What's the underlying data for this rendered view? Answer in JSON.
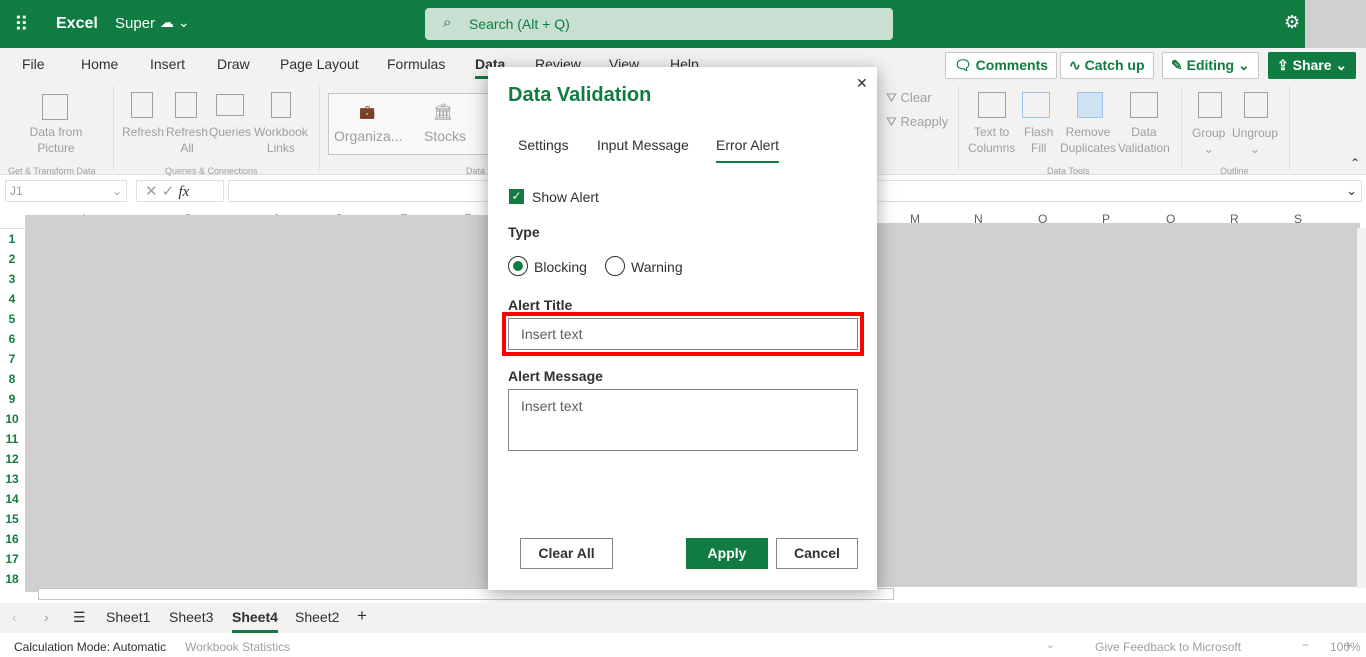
{
  "app": {
    "name": "Excel",
    "doc": "Super",
    "search_placeholder": "Search (Alt + Q)"
  },
  "tabs": [
    "File",
    "Home",
    "Insert",
    "Draw",
    "Page Layout",
    "Formulas",
    "Data",
    "Review",
    "View",
    "Help"
  ],
  "active_tab": "Data",
  "header_buttons": {
    "comments": "Comments",
    "catchup": "Catch up",
    "editing": "Editing",
    "share": "Share"
  },
  "ribbon": {
    "items": [
      {
        "l1": "Data from",
        "l2": "Picture"
      },
      {
        "l1": "Refresh",
        "l2": ""
      },
      {
        "l1": "Refresh",
        "l2": "All"
      },
      {
        "l1": "Queries",
        "l2": ""
      },
      {
        "l1": "Workbook",
        "l2": "Links"
      },
      {
        "l1": "Organiza...",
        "l2": ""
      },
      {
        "l1": "Stocks",
        "l2": ""
      },
      {
        "l1": "Clear",
        "l2": ""
      },
      {
        "l1": "Reapply",
        "l2": ""
      },
      {
        "l1": "Text to",
        "l2": "Columns"
      },
      {
        "l1": "Flash",
        "l2": "Fill"
      },
      {
        "l1": "Remove",
        "l2": "Duplicates"
      },
      {
        "l1": "Data",
        "l2": "Validation"
      },
      {
        "l1": "Group",
        "l2": "⌄"
      },
      {
        "l1": "Ungroup",
        "l2": "⌄"
      }
    ],
    "groups": [
      "Get & Transform Data",
      "Queries & Connections",
      "Data",
      "Data Tools",
      "Outline"
    ]
  },
  "namebox": "J1",
  "columns_left": [
    "A",
    "B",
    "C",
    "D",
    "E",
    "F"
  ],
  "columns_right": [
    "M",
    "N",
    "O",
    "P",
    "Q",
    "R",
    "S"
  ],
  "rows": [
    "1",
    "2",
    "3",
    "4",
    "5",
    "6",
    "7",
    "8",
    "9",
    "10",
    "11",
    "12",
    "13",
    "14",
    "15",
    "16",
    "17",
    "18"
  ],
  "dialog": {
    "title": "Data Validation",
    "tabs": [
      "Settings",
      "Input Message",
      "Error Alert"
    ],
    "active_tab": "Error Alert",
    "show_alert_label": "Show Alert",
    "show_alert_checked": true,
    "type_label": "Type",
    "type_options": [
      "Blocking",
      "Warning"
    ],
    "type_selected": "Blocking",
    "alert_title_label": "Alert Title",
    "alert_title_placeholder": "Insert text",
    "alert_message_label": "Alert Message",
    "alert_message_placeholder": "Insert text",
    "clear_all": "Clear All",
    "apply": "Apply",
    "cancel": "Cancel",
    "highlight_color": "#ff0000"
  },
  "sheets": [
    "Sheet1",
    "Sheet3",
    "Sheet4",
    "Sheet2"
  ],
  "active_sheet": "Sheet4",
  "status": {
    "calc": "Calculation Mode: Automatic",
    "stats": "Workbook Statistics",
    "feedback": "Give Feedback to Microsoft",
    "zoom": "100%"
  },
  "colors": {
    "brand": "#107c41"
  }
}
